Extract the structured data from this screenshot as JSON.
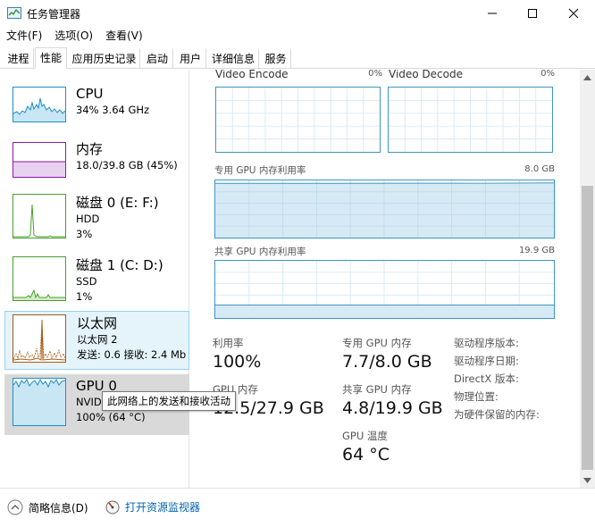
{
  "window": {
    "title": "任务管理器"
  },
  "menu": [
    {
      "label": "文件(F)"
    },
    {
      "label": "选项(O)"
    },
    {
      "label": "查看(V)"
    }
  ],
  "tabs": [
    {
      "label": "进程"
    },
    {
      "label": "性能"
    },
    {
      "label": "应用历史记录"
    },
    {
      "label": "启动"
    },
    {
      "label": "用户"
    },
    {
      "label": "详细信息"
    },
    {
      "label": "服务"
    }
  ],
  "resources": [
    {
      "name": "CPU",
      "line2": "34% 3.64 GHz",
      "line3": ""
    },
    {
      "name": "内存",
      "line2": "18.0/39.8 GB (45%)",
      "line3": ""
    },
    {
      "name": "磁盘 0 (E: F:)",
      "line2": "HDD",
      "line3": "3%"
    },
    {
      "name": "磁盘 1 (C: D:)",
      "line2": "SSD",
      "line3": "1%"
    },
    {
      "name": "以太网",
      "line2": "以太网 2",
      "line3": "发送: 0.6 接收: 2.4 Mb"
    },
    {
      "name": "GPU 0",
      "line2": "NVID",
      "line3": "100% (64 °C)"
    }
  ],
  "tooltip": "此网络上的发送和接收活动",
  "gpu": {
    "engines": [
      {
        "label": "Video Encode",
        "value": "0%"
      },
      {
        "label": "Video Decode",
        "value": "0%"
      }
    ],
    "dedicated_graph": {
      "label": "专用 GPU 内存利用率",
      "max": "8.0 GB"
    },
    "shared_graph": {
      "label": "共享 GPU 内存利用率",
      "max": "19.9 GB"
    },
    "stats": {
      "utilization": {
        "label": "利用率",
        "value": "100%"
      },
      "dedicated": {
        "label": "专用 GPU 内存",
        "value": "7.7/8.0 GB"
      },
      "gpu_memory": {
        "label": "GPU 内存",
        "value": "12.5/27.9 GB"
      },
      "shared": {
        "label": "共享 GPU 内存",
        "value": "4.8/19.9 GB"
      },
      "temperature": {
        "label": "GPU 温度",
        "value": "64 °C"
      }
    },
    "driver": {
      "version": "驱动程序版本:",
      "date": "驱动程序日期:",
      "directx": "DirectX 版本:",
      "location": "物理位置:",
      "reserved": "为硬件保留的内存:"
    }
  },
  "footer": {
    "summary": "简略信息(D)",
    "monitor": "打开资源监视器"
  },
  "colors": {
    "cpu": "#1b8fc7",
    "memory": "#8b1aa6",
    "disk": "#4aa02c",
    "ethernet": "#a75a16",
    "gpu": "#1b8fc7",
    "selected_bg": "#e5f3fb",
    "selected_border": "#99d1ef",
    "link": "#0063b1"
  }
}
